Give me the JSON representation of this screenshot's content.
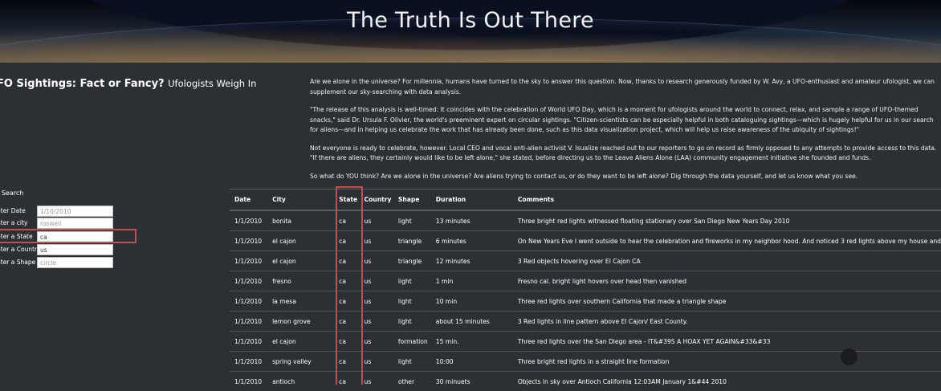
{
  "header": {
    "title": "The Truth Is Out There"
  },
  "article": {
    "heading_bold": "FO Sightings: Fact or Fancy?",
    "heading_small": "Ufologists Weigh In",
    "paragraphs": [
      "Are we alone in the universe? For millennia, humans have turned to the sky to answer this question. Now, thanks to research generously funded by W. Avy, a UFO-enthusiast and amateur ufologist, we can supplement our sky-searching with data analysis.",
      "\"The release of this analysis is well-timed: It coincides with the celebration of World UFO Day, which is a moment for ufologists around the world to connect, relax, and sample a range of UFO-themed snacks,\" said Dr. Ursula F. Olivier, the world's preeminent expert on circular sightings. \"Citizen-scientists can be especially helpful in both cataloguing sightings—which is hugely helpful for us in our search for aliens—and in helping us celebrate the work that has already been done, such as this data visualization project, which will help us raise awareness of the ubiquity of sightings!\"",
      "Not everyone is ready to celebrate, however. Local CEO and vocal anti-alien activist V. Isualize reached out to our reporters to go on record as firmly opposed to any attempts to provide access to this data. \"If there are aliens, they certainly would like to be left alone,\" she stated, before directing us to the Leave Aliens Alone (LAA) community engagement initiative she founded and funds.",
      "So what do YOU think? Are we alone in the universe? Are aliens trying to contact us, or do they want to be left alone? Dig through the data yourself, and let us know what you see."
    ]
  },
  "filters": {
    "title": "r Search",
    "date": {
      "label": "nter Date",
      "value": "",
      "placeholder": "1/10/2010"
    },
    "city": {
      "label": "nter a city",
      "value": "",
      "placeholder": "roswell"
    },
    "state": {
      "label": "nter a State",
      "value": "ca",
      "placeholder": ""
    },
    "country": {
      "label": "nter a Country",
      "value": "us",
      "placeholder": ""
    },
    "shape": {
      "label": "nter a Shape",
      "value": "",
      "placeholder": "circle"
    }
  },
  "table": {
    "headers": [
      "Date",
      "City",
      "State",
      "Country",
      "Shape",
      "Duration",
      "Comments"
    ],
    "rows": [
      [
        "1/1/2010",
        "bonita",
        "ca",
        "us",
        "light",
        "13 minutes",
        "Three bright red lights witnessed floating stationary over San Diego New Years Day 2010"
      ],
      [
        "1/1/2010",
        "el cajon",
        "ca",
        "us",
        "triangle",
        "6 minutes",
        "On New Years Eve I went outside to hear the celebration and fireworks in my neighbor hood. And noticed 3 red lights above my house and"
      ],
      [
        "1/1/2010",
        "el cajon",
        "ca",
        "us",
        "triangle",
        "12 minutes",
        "3 Red objects hovering over El Cajon CA"
      ],
      [
        "1/1/2010",
        "fresno",
        "ca",
        "us",
        "light",
        "1 min",
        "Fresno cal. bright light hovers over head then vanished"
      ],
      [
        "1/1/2010",
        "la mesa",
        "ca",
        "us",
        "light",
        "10 min",
        "Three red lights over southern California that made a triangle shape"
      ],
      [
        "1/1/2010",
        "lemon grove",
        "ca",
        "us",
        "light",
        "about 15 minutes",
        "3 Red lights in line pattern above El Cajon/ East County."
      ],
      [
        "1/1/2010",
        "el cajon",
        "ca",
        "us",
        "formation",
        "15 min.",
        "Three red lights over the San Diego area - IT&#39S A HOAX YET AGAIN&#33&#33"
      ],
      [
        "1/1/2010",
        "spring valley",
        "ca",
        "us",
        "light",
        "10:00",
        "Three bright red lights in a straight line formation"
      ],
      [
        "1/1/2010",
        "antioch",
        "ca",
        "us",
        "other",
        "30 minuets",
        "Objects in sky over Antioch California 12:03AM January 1&#44 2010"
      ]
    ]
  }
}
